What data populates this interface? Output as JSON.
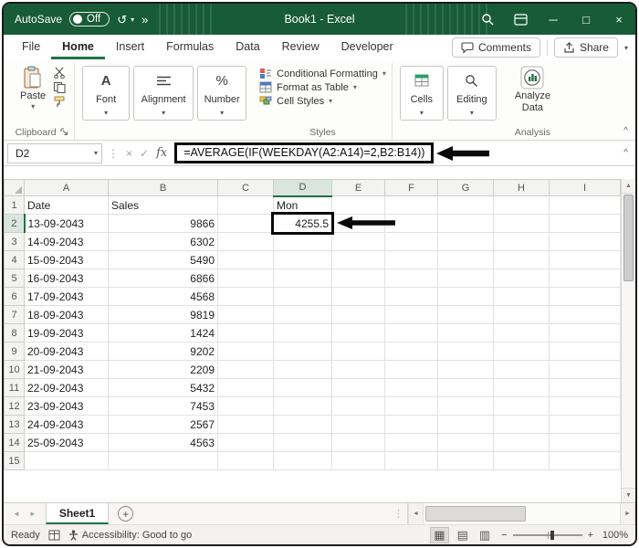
{
  "colors": {
    "titlebar_green": "#185C37",
    "accent_green": "#217346",
    "selected_header_bg": "#D9E5DE",
    "annotation_black": "#0A0A0A"
  },
  "title_bar": {
    "autosave_label": "AutoSave",
    "autosave_state": "Off",
    "more_commands": "»",
    "title": "Book1 - Excel"
  },
  "ribbon": {
    "tabs": [
      "File",
      "Home",
      "Insert",
      "Formulas",
      "Data",
      "Review",
      "Developer"
    ],
    "active_tab": "Home",
    "comments_label": "Comments",
    "share_label": "Share",
    "clipboard": {
      "paste_label": "Paste",
      "group_label": "Clipboard"
    },
    "font": {
      "label": "Font",
      "icon_letter": "A"
    },
    "alignment": {
      "label": "Alignment"
    },
    "number": {
      "label": "Number",
      "icon": "%"
    },
    "styles": {
      "items": [
        "Conditional Formatting",
        "Format as Table",
        "Cell Styles"
      ],
      "group_label": "Styles"
    },
    "cells": {
      "label": "Cells"
    },
    "editing": {
      "label": "Editing"
    },
    "analysis": {
      "button_line1": "Analyze",
      "button_line2": "Data",
      "group_label": "Analysis"
    }
  },
  "formula_bar": {
    "name_box": "D2",
    "fx_label": "fx",
    "formula": "=AVERAGE(IF(WEEKDAY(A2:A14)=2,B2:B14))"
  },
  "grid": {
    "col_headers": [
      "A",
      "B",
      "C",
      "D",
      "E",
      "F",
      "G",
      "H",
      "I"
    ],
    "selection": {
      "cell": "D2",
      "col": "D",
      "row": "2"
    },
    "rows": [
      {
        "n": "1",
        "A": "Date",
        "B": "Sales",
        "D": "Mon"
      },
      {
        "n": "2",
        "A": "13-09-2043",
        "B": "9866",
        "D": "4255.5"
      },
      {
        "n": "3",
        "A": "14-09-2043",
        "B": "6302"
      },
      {
        "n": "4",
        "A": "15-09-2043",
        "B": "5490"
      },
      {
        "n": "5",
        "A": "16-09-2043",
        "B": "6866"
      },
      {
        "n": "6",
        "A": "17-09-2043",
        "B": "4568"
      },
      {
        "n": "7",
        "A": "18-09-2043",
        "B": "9819"
      },
      {
        "n": "8",
        "A": "19-09-2043",
        "B": "1424"
      },
      {
        "n": "9",
        "A": "20-09-2043",
        "B": "9202"
      },
      {
        "n": "10",
        "A": "21-09-2043",
        "B": "2209"
      },
      {
        "n": "11",
        "A": "22-09-2043",
        "B": "5432"
      },
      {
        "n": "12",
        "A": "23-09-2043",
        "B": "7453"
      },
      {
        "n": "13",
        "A": "24-09-2043",
        "B": "2567"
      },
      {
        "n": "14",
        "A": "25-09-2043",
        "B": "4563"
      },
      {
        "n": "15"
      }
    ]
  },
  "sheet_bar": {
    "active_tab": "Sheet1"
  },
  "status_bar": {
    "mode": "Ready",
    "accessibility": "Accessibility: Good to go",
    "zoom_level": "100%"
  },
  "icons": {
    "dropdown": "▾",
    "undo": "↺",
    "minimize": "─",
    "maximize": "□",
    "close": "×",
    "cancel": "×",
    "enter": "✓",
    "splitter_dots": "⋮",
    "scroll_up": "▲",
    "scroll_down": "▼",
    "scroll_left": "◄",
    "scroll_right": "►",
    "nav_left": "◄",
    "nav_right": "►",
    "new_sheet": "+",
    "collapse_ribbon": "^",
    "expand_formula_bar": "^",
    "view_normal": "▦",
    "view_layout": "▤",
    "view_break": "▥",
    "zoom_out": "−",
    "zoom_in": "+"
  }
}
